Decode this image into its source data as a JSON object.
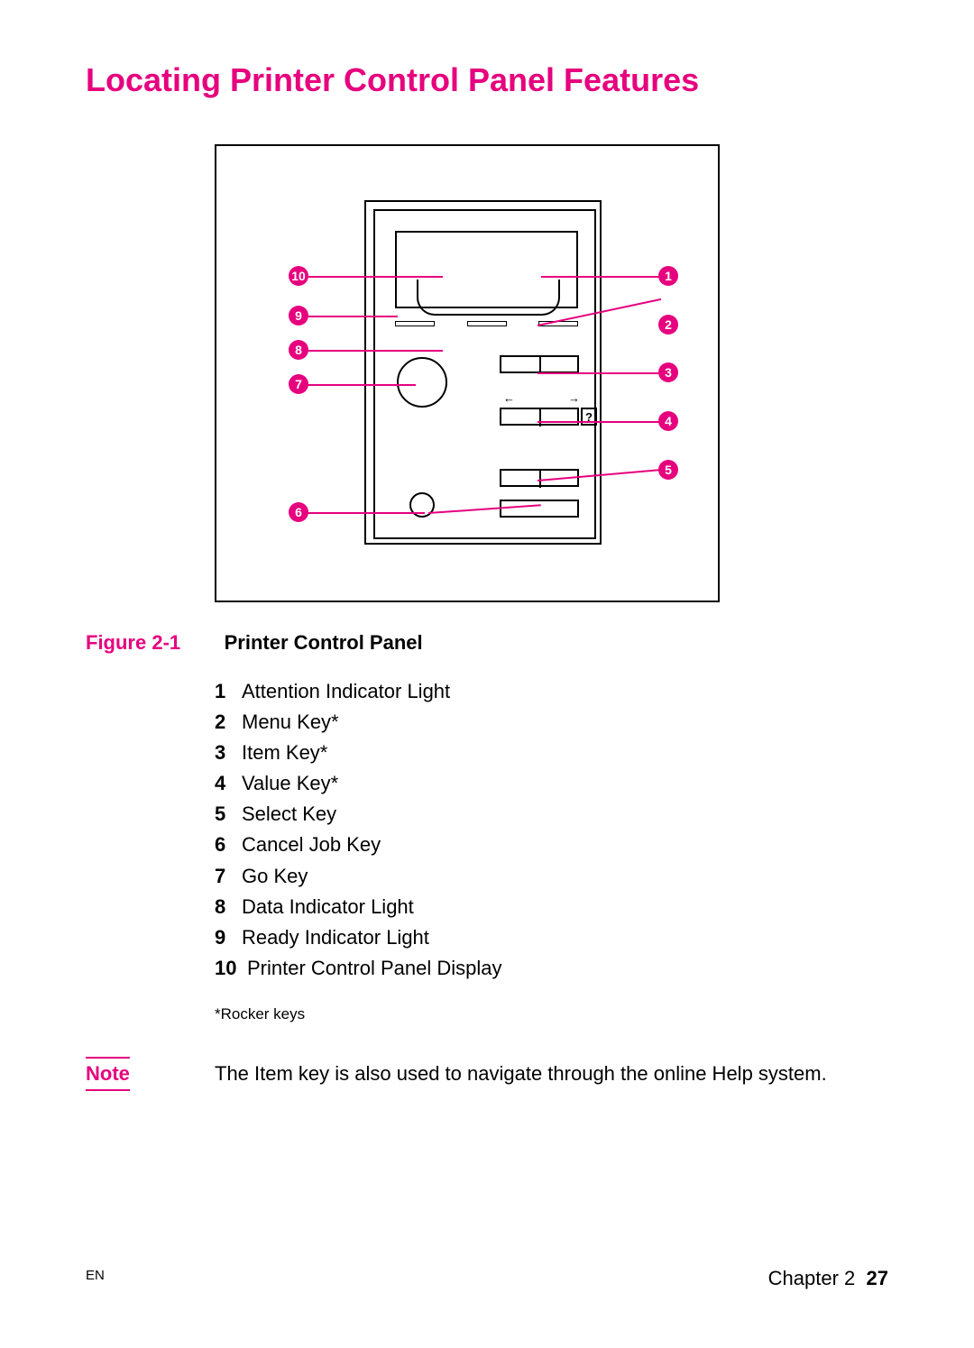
{
  "title": "Locating Printer Control Panel Features",
  "help_glyph": "?",
  "arrow_left": "←",
  "arrow_right": "→",
  "callouts": {
    "c1": "1",
    "c2": "2",
    "c3": "3",
    "c4": "4",
    "c5": "5",
    "c6": "6",
    "c7": "7",
    "c8": "8",
    "c9": "9",
    "c10": "10"
  },
  "figure": {
    "label": "Figure 2-1",
    "title": "Printer Control Panel"
  },
  "legend": [
    {
      "n": "1",
      "t": "Attention Indicator Light"
    },
    {
      "n": "2",
      "t": "Menu Key*"
    },
    {
      "n": "3",
      "t": "Item Key*"
    },
    {
      "n": "4",
      "t": "Value Key*"
    },
    {
      "n": "5",
      "t": "Select Key"
    },
    {
      "n": "6",
      "t": "Cancel Job Key"
    },
    {
      "n": "7",
      "t": "Go Key"
    },
    {
      "n": "8",
      "t": "Data Indicator Light"
    },
    {
      "n": "9",
      "t": "Ready Indicator Light"
    },
    {
      "n": "10",
      "t": "Printer Control Panel Display"
    }
  ],
  "footnote": "*Rocker keys",
  "note": {
    "label": "Note",
    "text": "The Item key is also used to navigate through the online Help system."
  },
  "footer": {
    "left": "EN",
    "chapter": "Chapter 2",
    "page": "27"
  }
}
